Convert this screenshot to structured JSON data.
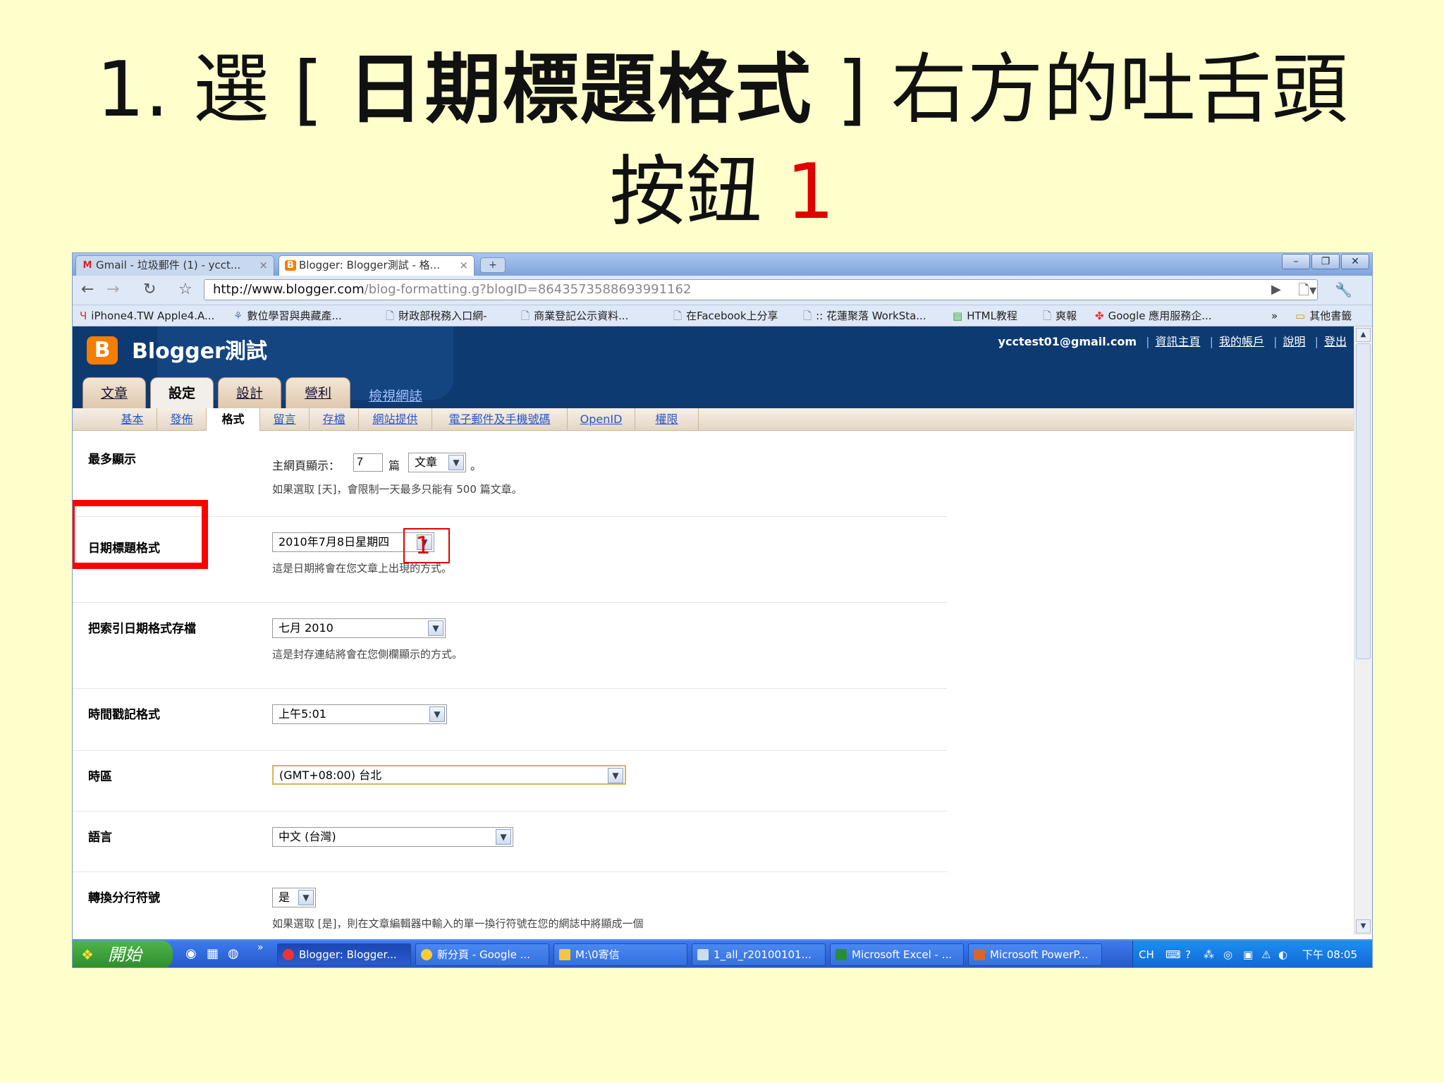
{
  "slide": {
    "title_prefix": "1. 選 [ ",
    "title_bold": "日期標題格式",
    "title_suffix": " ] 右方的吐舌頭",
    "title_line2": "按鈕 ",
    "step_number": "1"
  },
  "browser": {
    "tabs": [
      {
        "label": "Gmail - 垃圾郵件 (1) - ycct...",
        "icon": "gmail-icon"
      },
      {
        "label": "Blogger: Blogger測試 - 格...",
        "icon": "blogger-icon"
      }
    ],
    "url_domain": "http://www.blogger.com",
    "url_path": "/blog-formatting.g?blogID=8643573588693991162",
    "bookmarks": [
      "iPhone4.TW Apple4.A...",
      "數位學習與典藏產...",
      "財政部稅務入口網-",
      "商業登記公示資料...",
      "在Facebook上分享",
      ":: 花蓮聚落 WorkSta...",
      "HTML教程",
      "爽報",
      "Google 應用服務企...",
      "其他書籤"
    ]
  },
  "blogger": {
    "blog_name": "Blogger測試",
    "email": "ycctest01@gmail.com",
    "links": [
      "資訊主頁",
      "我的帳戶",
      "說明",
      "登出"
    ],
    "main_tabs": [
      "文章",
      "設定",
      "設計",
      "營利"
    ],
    "view_blog": "檢視網誌",
    "sub_tabs": [
      "基本",
      "發佈",
      "格式",
      "留言",
      "存檔",
      "網站提供",
      "電子郵件及手機號碼",
      "OpenID",
      "權限"
    ]
  },
  "settings": {
    "max_show": {
      "label": "最多顯示",
      "prefix": "主網頁顯示：",
      "value": "7",
      "unit": "篇",
      "type_value": "文章",
      "suffix": "。",
      "help": "如果選取 [天]，會限制一天最多只能有 500 篇文章。"
    },
    "date_header": {
      "label": "日期標題格式",
      "value": "2010年7月8日星期四",
      "help": "這是日期將會在您文章上出現的方式。"
    },
    "archive_date": {
      "label": "把索引日期格式存檔",
      "value": "七月 2010",
      "help": "這是封存連結將會在您側欄顯示的方式。"
    },
    "timestamp": {
      "label": "時間戳記格式",
      "value": "上午5:01"
    },
    "timezone": {
      "label": "時區",
      "value": "(GMT+08:00) 台北"
    },
    "language": {
      "label": "語言",
      "value": "中文 (台灣)"
    },
    "line_breaks": {
      "label": "轉換分行符號",
      "value": "是",
      "help": "如果選取 [是]，則在文章編輯器中輸入的單一換行符號在您的網誌中將顯成一個"
    }
  },
  "taskbar": {
    "start": "開始",
    "items": [
      {
        "label": "Blogger: Blogger...",
        "icon": "chrome-icon"
      },
      {
        "label": "新分頁 - Google ...",
        "icon": "chrome-icon"
      },
      {
        "label": "M:\\0寄信",
        "icon": "folder-icon"
      },
      {
        "label": "1_all_r20100101...",
        "icon": "document-icon"
      },
      {
        "label": "Microsoft Excel - ...",
        "icon": "excel-icon"
      },
      {
        "label": "Microsoft PowerP...",
        "icon": "powerpoint-icon"
      }
    ],
    "lang": "CH",
    "clock": "下午 08:05"
  }
}
